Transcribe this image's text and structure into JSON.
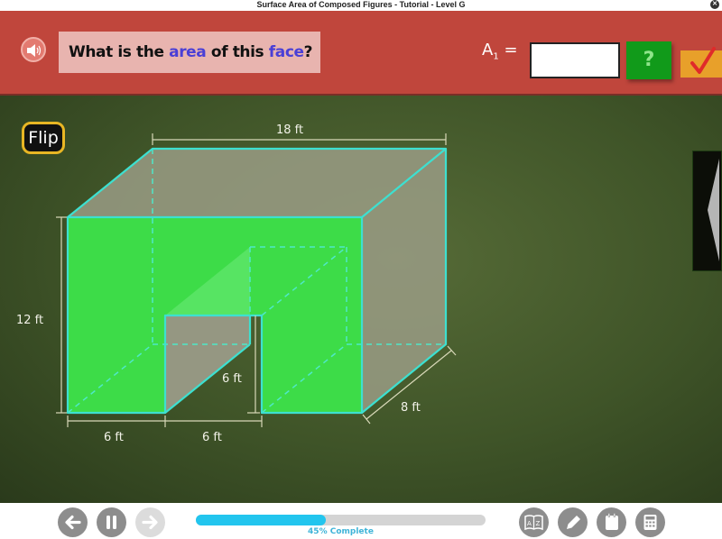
{
  "window": {
    "title": "Surface Area of Composed Figures - Tutorial - Level G",
    "close_icon": "close-x-icon"
  },
  "header": {
    "speaker_icon": "speaker-icon",
    "question": {
      "part1": "What is the ",
      "highlight1": "area",
      "part2": " of this ",
      "highlight2": "face",
      "part3": "?"
    },
    "answer_label": "A",
    "answer_subscript": "1",
    "answer_equals": "=",
    "answer_value": "",
    "hint_label": "?",
    "check_icon": "checkmark-icon",
    "colors": {
      "bar": "#c0463c",
      "highlight": "#4a3fd6",
      "hint": "#119a1a",
      "check": "#e8a02a"
    }
  },
  "stage": {
    "flip_label": "Flip",
    "side_tab_icon": "chevron-left-icon",
    "figure": {
      "dimensions": {
        "length": "18 ft",
        "height": "12 ft",
        "depth": "8 ft",
        "bottom_left": "6 ft",
        "bottom_middle": "6 ft",
        "notch_height": "6 ft"
      },
      "highlighted_face_color": "#3de04a",
      "edge_color": "#3de0d0"
    }
  },
  "footer": {
    "back_icon": "arrow-left-icon",
    "pause_icon": "pause-icon",
    "forward_icon": "arrow-right-icon",
    "progress_percent": 45,
    "progress_label": "45% Complete",
    "tools": [
      {
        "name": "glossary",
        "icon": "glossary-book-icon"
      },
      {
        "name": "pencil",
        "icon": "pencil-icon"
      },
      {
        "name": "notepad",
        "icon": "notepad-icon"
      },
      {
        "name": "calculator",
        "icon": "calculator-icon"
      }
    ]
  }
}
